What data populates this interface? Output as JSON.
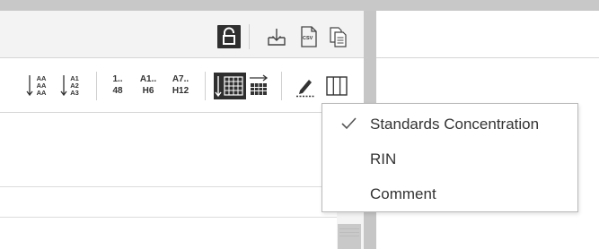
{
  "header": {
    "icons": [
      "unlock-icon",
      "download-icon",
      "csv-file-icon",
      "copy-icon"
    ],
    "csv_label": "CSV"
  },
  "toolbar": {
    "sort_az_top": "AA",
    "sort_az_mid": "AA",
    "sort_az_bot": "AA",
    "sort_a1_top": "A1",
    "sort_a1_mid": "A2",
    "sort_a1_bot": "A3",
    "range_1_top": "1..",
    "range_1_bot": "48",
    "range_a1_top": "A1..",
    "range_a1_bot": "H6",
    "range_a7_top": "A7..",
    "range_a7_bot": "H12",
    "icons": [
      "sort-alpha-icon",
      "sort-well-icon",
      "column-layout-icon",
      "row-layout-icon",
      "edit-icon",
      "column-chooser-icon"
    ]
  },
  "column_menu": {
    "items": [
      {
        "label": "Standards Concentration",
        "checked": true
      },
      {
        "label": "RIN",
        "checked": false
      },
      {
        "label": "Comment",
        "checked": false
      }
    ]
  },
  "colors": {
    "accent_dark": "#2f2f2f",
    "text": "#333333",
    "divider": "#c6c6c6"
  }
}
